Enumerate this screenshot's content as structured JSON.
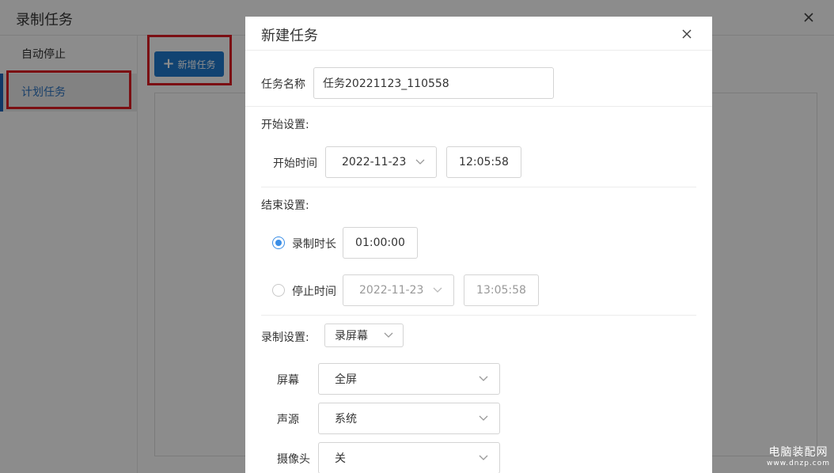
{
  "bg": {
    "title": "录制任务",
    "sidebar": [
      {
        "label": "自动停止"
      },
      {
        "label": "计划任务"
      }
    ],
    "add_button": "新增任务"
  },
  "modal": {
    "title": "新建任务",
    "task_name_label": "任务名称",
    "task_name_value": "任务20221123_110558",
    "start_section": "开始设置:",
    "start_time_label": "开始时间",
    "start_date": "2022-11-23",
    "start_time": "12:05:58",
    "end_section": "结束设置:",
    "duration_label": "录制时长",
    "duration_value": "01:00:00",
    "stop_time_label": "停止时间",
    "stop_date": "2022-11-23",
    "stop_time": "13:05:58",
    "record_section": "录制设置:",
    "record_mode": "录屏幕",
    "screen_label": "屏幕",
    "screen_value": "全屏",
    "audio_label": "声源",
    "audio_value": "系统",
    "camera_label": "摄像头",
    "camera_value": "关"
  },
  "watermark": {
    "line1": "电脑装配网",
    "line2": "www.dnzp.com"
  },
  "colors": {
    "accent": "#1f7ad0",
    "radio": "#3b8ee6",
    "highlight_box": "#e01d24"
  }
}
